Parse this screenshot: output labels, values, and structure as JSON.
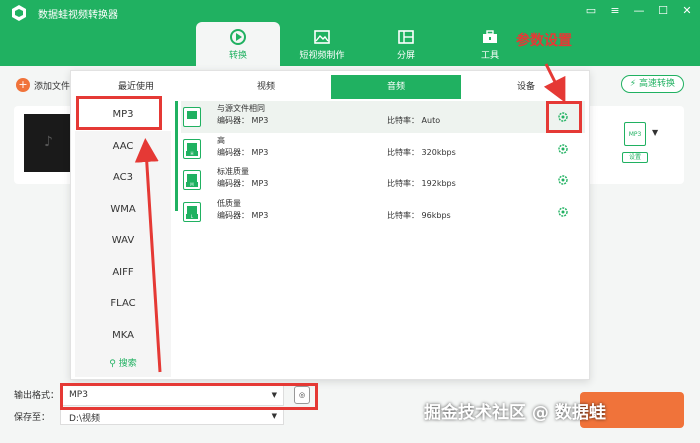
{
  "app": {
    "title": "数据蛙视频转换器"
  },
  "nav": [
    {
      "label": "转换",
      "icon": "convert-icon"
    },
    {
      "label": "短视频制作",
      "icon": "video-maker-icon"
    },
    {
      "label": "分屏",
      "icon": "split-screen-icon"
    },
    {
      "label": "工具",
      "icon": "toolbox-icon"
    }
  ],
  "toolbar": {
    "add_file_label": "添加文件",
    "fast_convert_label": "高速转换"
  },
  "file_card": {
    "format_badge": "MP3",
    "settings_label": "设置"
  },
  "panel": {
    "tabs": [
      "最近使用",
      "视频",
      "音频",
      "设备"
    ],
    "formats": [
      "MP3",
      "AAC",
      "AC3",
      "WMA",
      "WAV",
      "AIFF",
      "FLAC",
      "MKA"
    ],
    "search_label": "搜索",
    "encoder_label": "编码器：",
    "bitrate_label": "比特率：",
    "qualities": [
      {
        "name": "与源文件相同",
        "encoder": "MP3",
        "bitrate": "Auto",
        "tag": ""
      },
      {
        "name": "高",
        "encoder": "MP3",
        "bitrate": "320kbps",
        "tag": "H"
      },
      {
        "name": "标准质量",
        "encoder": "MP3",
        "bitrate": "192kbps",
        "tag": "M"
      },
      {
        "name": "低质量",
        "encoder": "MP3",
        "bitrate": "96kbps",
        "tag": "L"
      }
    ]
  },
  "output": {
    "format_label": "输出格式：",
    "format_value": "MP3",
    "save_label": "保存至：",
    "save_path": "D:\\视频"
  },
  "annotation": {
    "label": "参数设置"
  },
  "watermark": "掘金技术社区 @ 数据蛙",
  "colors": {
    "brand": "#20b161",
    "accent": "#f0733a",
    "annotation": "#e53935"
  }
}
